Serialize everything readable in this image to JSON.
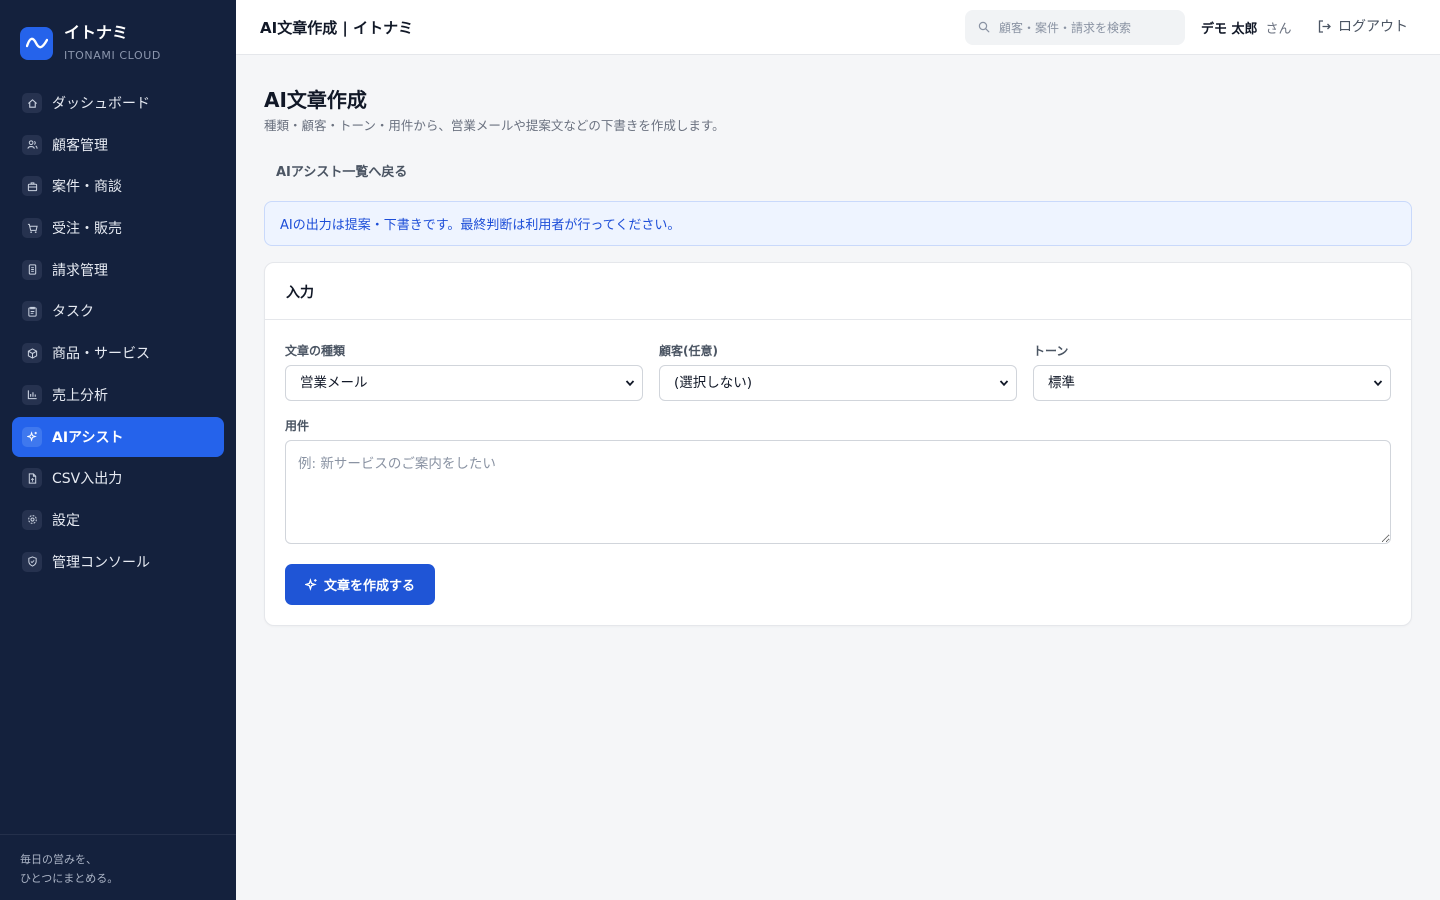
{
  "brand": {
    "name": "イトナミ",
    "sub": "ITONAMI CLOUD"
  },
  "nav": [
    {
      "label": "ダッシュボード",
      "icon": "home-icon",
      "active": false
    },
    {
      "label": "顧客管理",
      "icon": "users-icon",
      "active": false
    },
    {
      "label": "案件・商談",
      "icon": "briefcase-icon",
      "active": false
    },
    {
      "label": "受注・販売",
      "icon": "cart-icon",
      "active": false
    },
    {
      "label": "請求管理",
      "icon": "invoice-icon",
      "active": false
    },
    {
      "label": "タスク",
      "icon": "clipboard-icon",
      "active": false
    },
    {
      "label": "商品・サービス",
      "icon": "box-icon",
      "active": false
    },
    {
      "label": "売上分析",
      "icon": "bar-chart-icon",
      "active": false
    },
    {
      "label": "AIアシスト",
      "icon": "sparkle-icon",
      "active": true
    },
    {
      "label": "CSV入出力",
      "icon": "file-icon",
      "active": false
    },
    {
      "label": "設定",
      "icon": "gear-icon",
      "active": false
    },
    {
      "label": "管理コンソール",
      "icon": "shield-icon",
      "active": false
    }
  ],
  "sidebar_footer": {
    "line1": "毎日の営みを、",
    "line2": "ひとつにまとめる。"
  },
  "header": {
    "title": "AI文章作成 | イトナミ",
    "search_placeholder": "顧客・案件・請求を検索",
    "user_name": "デモ 太郎",
    "user_suffix": "さん",
    "logout_label": "ログアウト"
  },
  "page": {
    "title": "AI文章作成",
    "description": "種類・顧客・トーン・用件から、営業メールや提案文などの下書きを作成します。",
    "back_link": "AIアシスト一覧へ戻る",
    "notice": "AIの出力は提案・下書きです。最終判断は利用者が行ってください。"
  },
  "form": {
    "card_title": "入力",
    "type_label": "文章の種類",
    "type_value": "営業メール",
    "customer_label": "顧客(任意)",
    "customer_value": "(選択しない)",
    "tone_label": "トーン",
    "tone_value": "標準",
    "purpose_label": "用件",
    "purpose_placeholder": "例: 新サービスのご案内をしたい",
    "submit_label": "文章を作成する"
  },
  "colors": {
    "sidebar_bg": "#14213d",
    "accent": "#2563eb",
    "button": "#1f55d6",
    "notice_bg": "#eef4ff",
    "notice_text": "#1d4ed8"
  }
}
